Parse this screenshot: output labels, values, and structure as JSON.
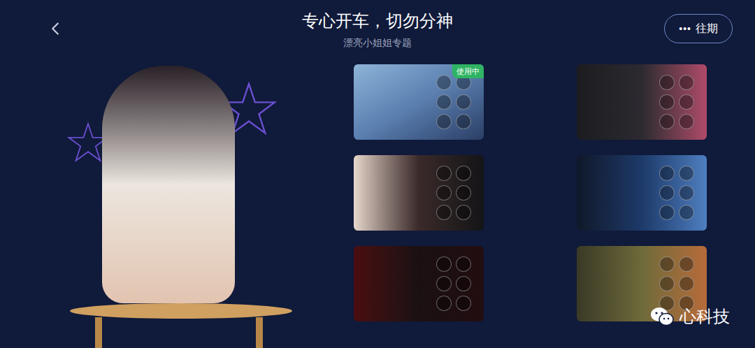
{
  "header": {
    "title": "专心开车，切勿分神",
    "subtitle": "漂亮小姐姐专题",
    "history_button": {
      "dots": "•••",
      "label": "往期"
    }
  },
  "themes": [
    {
      "selected": true,
      "badge": "使用中"
    },
    {
      "selected": false,
      "badge": ""
    },
    {
      "selected": false,
      "badge": ""
    },
    {
      "selected": false,
      "badge": ""
    },
    {
      "selected": false,
      "badge": ""
    },
    {
      "selected": false,
      "badge": ""
    }
  ],
  "watermark": {
    "text": "心科技"
  }
}
